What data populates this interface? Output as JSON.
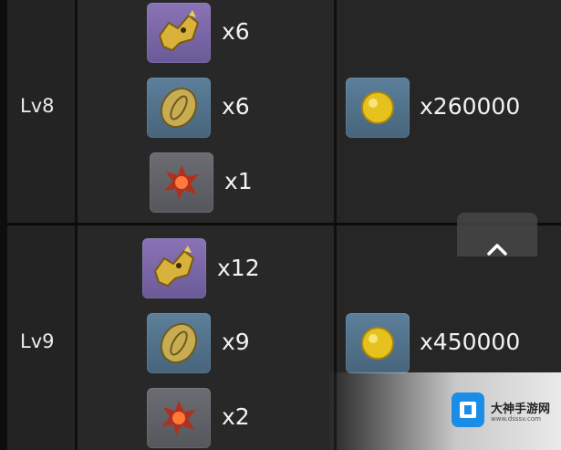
{
  "rows": [
    {
      "level": "Lv8",
      "materials": [
        {
          "icon": "gold-beast-figurine-icon",
          "quantity": "x6"
        },
        {
          "icon": "ancient-coin-icon",
          "quantity": "x6"
        },
        {
          "icon": "red-crystal-core-icon",
          "quantity": "x1"
        }
      ],
      "gold": {
        "icon": "gold-coin-icon",
        "quantity": "x260000"
      }
    },
    {
      "level": "Lv9",
      "materials": [
        {
          "icon": "gold-beast-figurine-icon",
          "quantity": "x12"
        },
        {
          "icon": "ancient-coin-icon",
          "quantity": "x9"
        },
        {
          "icon": "red-crystal-core-icon",
          "quantity": "x2"
        }
      ],
      "gold": {
        "icon": "gold-coin-icon",
        "quantity": "x450000"
      }
    }
  ],
  "scroll_top_icon": "chevron-up-icon",
  "watermark": {
    "name": "大神手游网",
    "url": "www.dsssv.com"
  },
  "colors": {
    "rarity_purple": "#7b66a8",
    "rarity_blue": "#557489",
    "rarity_gray": "#616369",
    "text": "#f2f2f2"
  }
}
